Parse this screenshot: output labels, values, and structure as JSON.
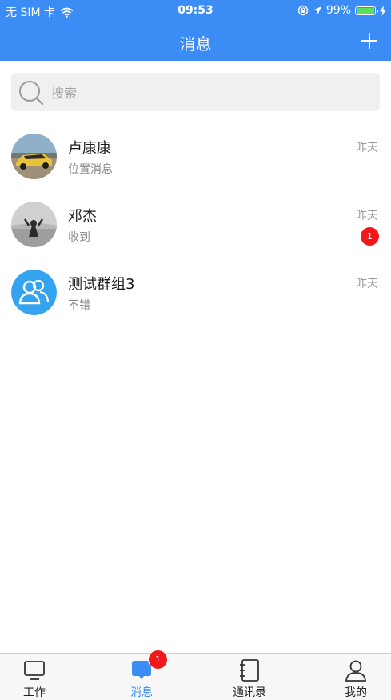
{
  "status_bar": {
    "carrier": "无 SIM 卡",
    "time": "09:53",
    "battery": "99%",
    "battery_level": 0.99,
    "battery_color": "#5be05b"
  },
  "nav": {
    "title": "消息",
    "background": "#3b8cf4"
  },
  "search": {
    "placeholder": "搜索"
  },
  "conversations": [
    {
      "name": "卢康康",
      "preview": "位置消息",
      "time": "昨天",
      "avatar": "car-photo"
    },
    {
      "name": "邓杰",
      "preview": "收到",
      "time": "昨天",
      "badge": "1",
      "avatar": "person-photo"
    },
    {
      "name": "测试群组3",
      "preview": "不错",
      "time": "昨天",
      "avatar": "group-icon"
    }
  ],
  "tabs": [
    {
      "label": "工作",
      "icon": "monitor-icon"
    },
    {
      "label": "消息",
      "icon": "chat-icon",
      "badge": "1",
      "active": true
    },
    {
      "label": "通讯录",
      "icon": "contacts-book-icon"
    },
    {
      "label": "我的",
      "icon": "user-icon"
    }
  ],
  "colors": {
    "accent": "#3b8cf4",
    "badge": "#f01818"
  }
}
